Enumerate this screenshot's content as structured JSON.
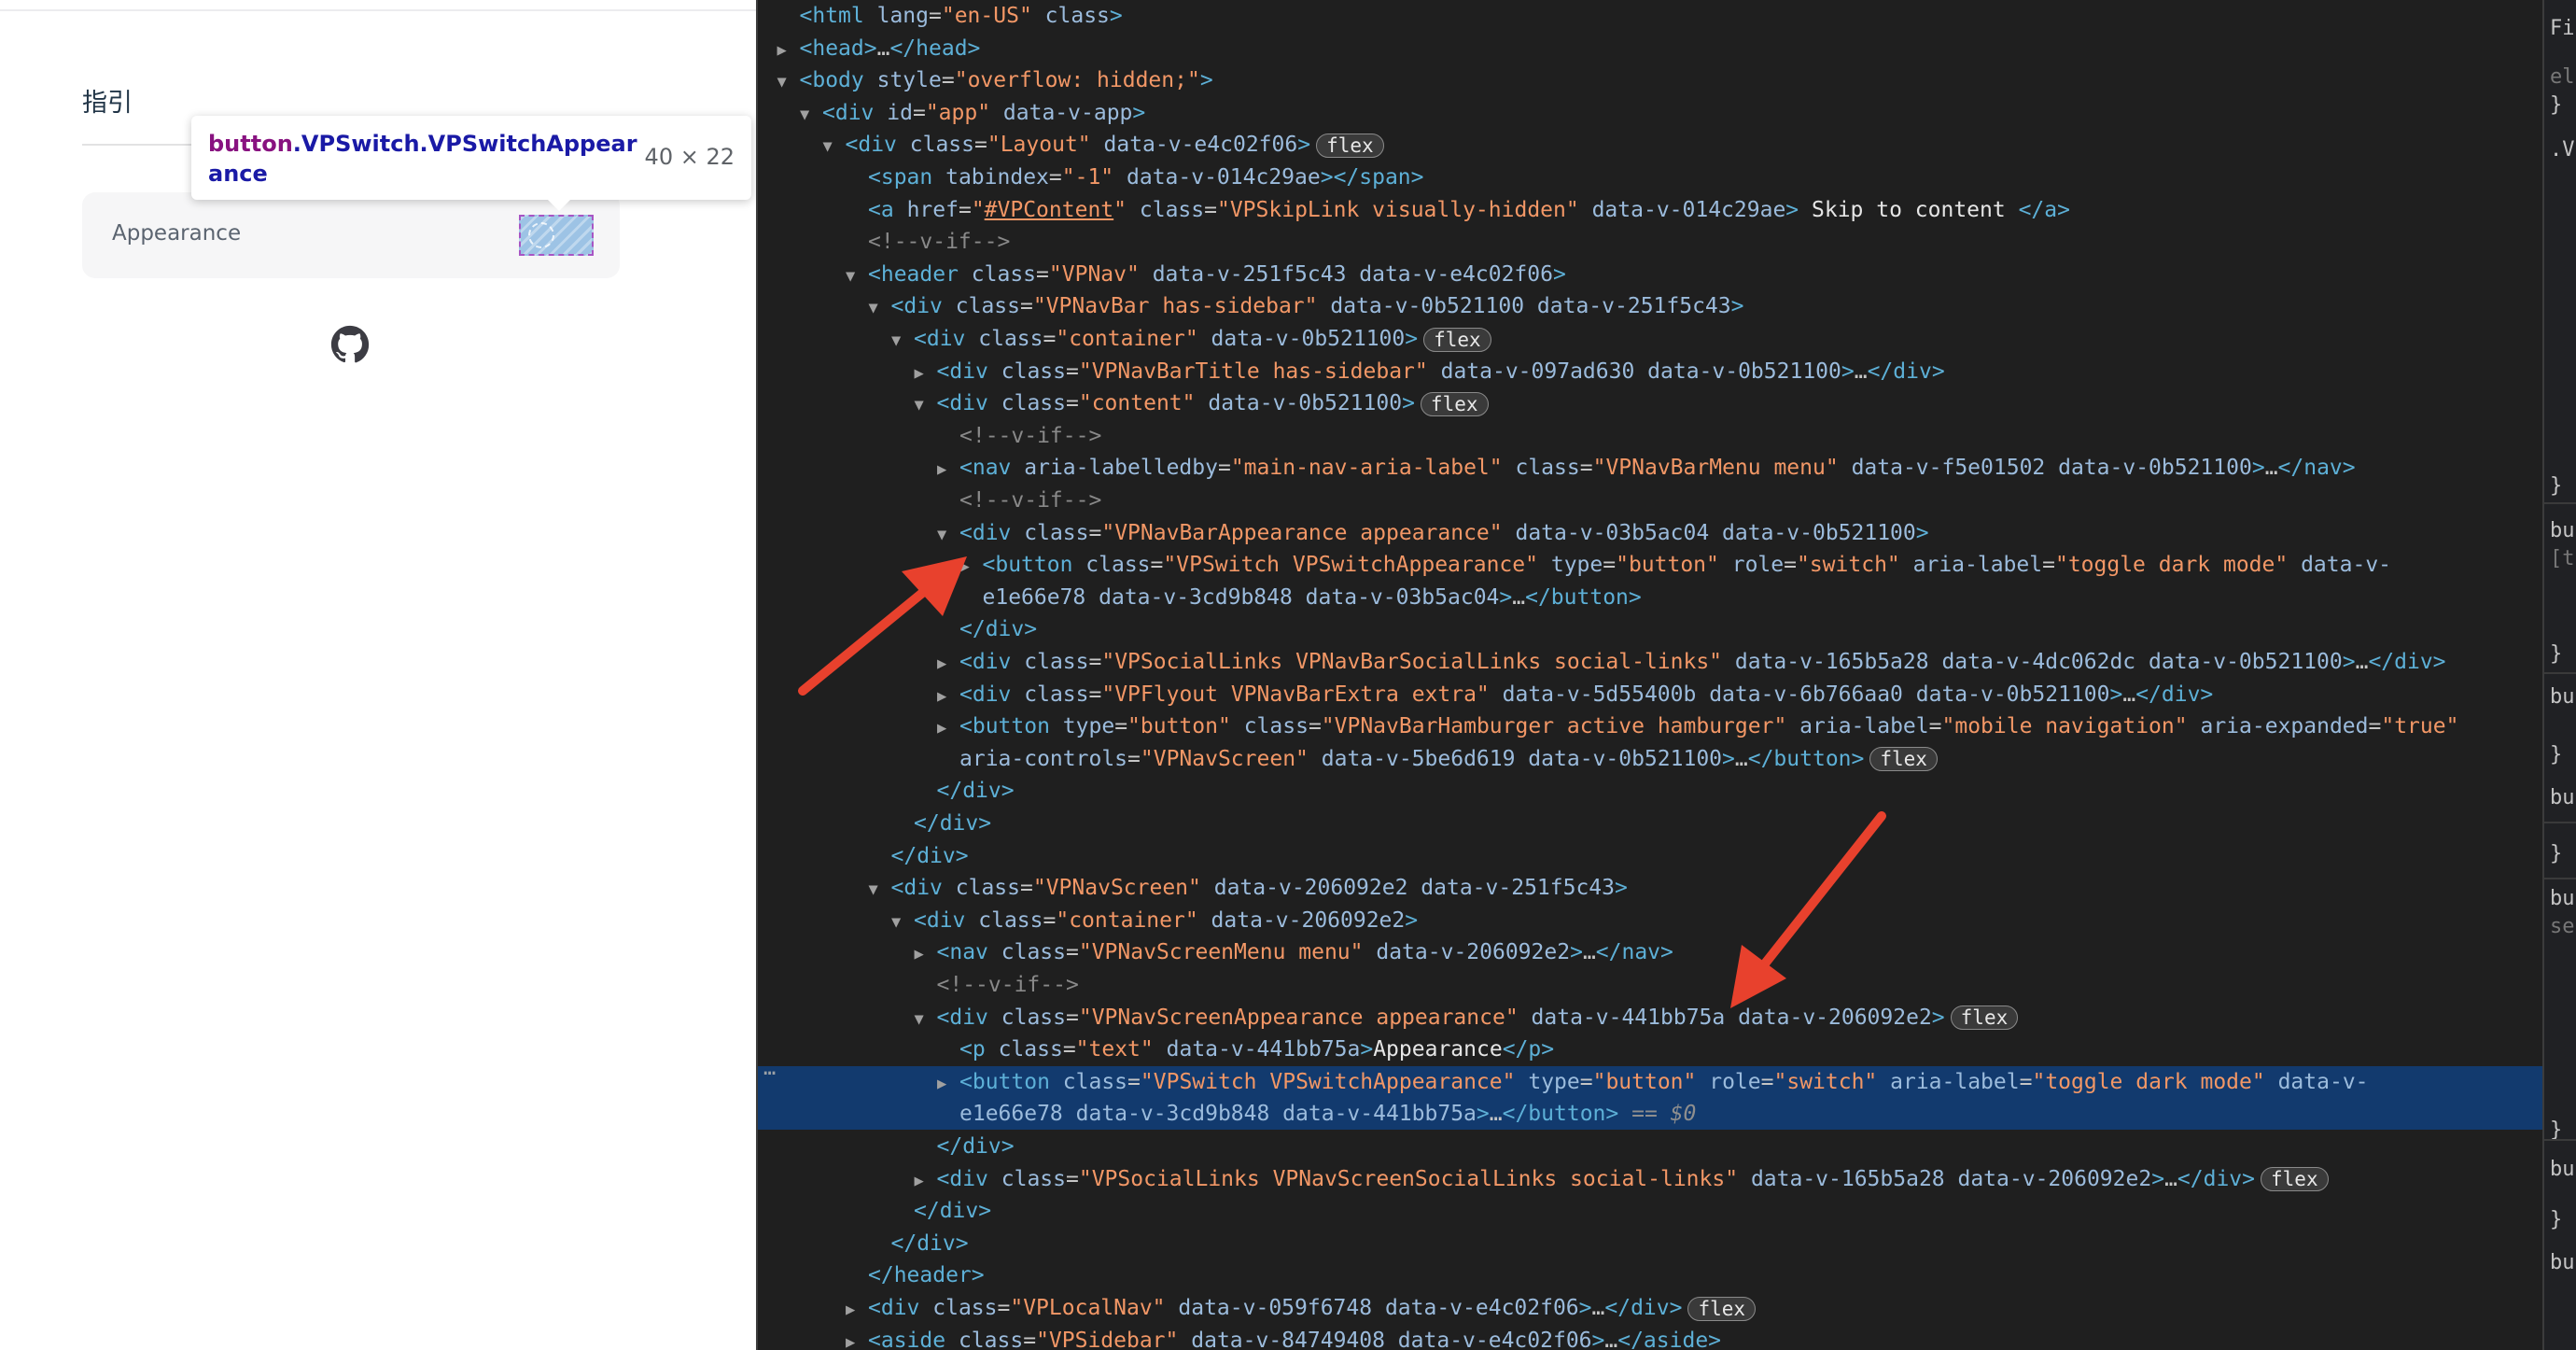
{
  "preview": {
    "nav_title": "指引",
    "appearance_label": "Appearance",
    "tooltip": {
      "tag": "button",
      "classes": ".VPSwitch.VPSwitchAppearance",
      "size": "40 × 22"
    }
  },
  "devtools": {
    "lines": [
      {
        "indent": 1,
        "tw": "",
        "html": "<span class='tag'>&lt;html</span> <span class='an'>lang</span>=<span class='av'>\"en-US\"</span> <span class='an'>class</span><span class='tag'>&gt;</span>"
      },
      {
        "indent": 1,
        "tw": "▶",
        "html": "<span class='tag'>&lt;head&gt;</span>…<span class='tag'>&lt;/head&gt;</span>"
      },
      {
        "indent": 1,
        "tw": "▼",
        "html": "<span class='tag'>&lt;body</span> <span class='an'>style</span>=<span class='av'>\"overflow: hidden;\"</span><span class='tag'>&gt;</span>"
      },
      {
        "indent": 2,
        "tw": "▼",
        "html": "<span class='tag'>&lt;div</span> <span class='an'>id</span>=<span class='av'>\"app\"</span> <span class='an'>data-v-app</span><span class='tag'>&gt;</span>"
      },
      {
        "indent": 3,
        "tw": "▼",
        "html": "<span class='tag'>&lt;div</span> <span class='an'>class</span>=<span class='av'>\"Layout\"</span> <span class='an'>data-v-e4c02f06</span><span class='tag'>&gt;</span>",
        "badge": "flex"
      },
      {
        "indent": 4,
        "tw": "",
        "html": "<span class='tag'>&lt;span</span> <span class='an'>tabindex</span>=<span class='av'>\"-1\"</span> <span class='an'>data-v-014c29ae</span><span class='tag'>&gt;&lt;/span&gt;</span>"
      },
      {
        "indent": 4,
        "tw": "",
        "html": "<span class='tag'>&lt;a</span> <span class='an'>href</span>=<span class='av'>\"</span><span class='lnk'>#VPContent</span><span class='av'>\"</span> <span class='an'>class</span>=<span class='av'>\"VPSkipLink visually-hidden\"</span> <span class='an'>data-v-014c29ae</span><span class='tag'>&gt;</span><span class='tx'> Skip to content </span><span class='tag'>&lt;/a&gt;</span>"
      },
      {
        "indent": 4,
        "tw": "",
        "html": "<span class='cm'>&lt;!--v-if--&gt;</span>"
      },
      {
        "indent": 4,
        "tw": "▼",
        "html": "<span class='tag'>&lt;header</span> <span class='an'>class</span>=<span class='av'>\"VPNav\"</span> <span class='an'>data-v-251f5c43 data-v-e4c02f06</span><span class='tag'>&gt;</span>"
      },
      {
        "indent": 5,
        "tw": "▼",
        "html": "<span class='tag'>&lt;div</span> <span class='an'>class</span>=<span class='av'>\"VPNavBar has-sidebar\"</span> <span class='an'>data-v-0b521100 data-v-251f5c43</span><span class='tag'>&gt;</span>"
      },
      {
        "indent": 6,
        "tw": "▼",
        "html": "<span class='tag'>&lt;div</span> <span class='an'>class</span>=<span class='av'>\"container\"</span> <span class='an'>data-v-0b521100</span><span class='tag'>&gt;</span>",
        "badge": "flex"
      },
      {
        "indent": 7,
        "tw": "▶",
        "html": "<span class='tag'>&lt;div</span> <span class='an'>class</span>=<span class='av'>\"VPNavBarTitle has-sidebar\"</span> <span class='an'>data-v-097ad630 data-v-0b521100</span><span class='tag'>&gt;</span>…<span class='tag'>&lt;/div&gt;</span>"
      },
      {
        "indent": 7,
        "tw": "▼",
        "html": "<span class='tag'>&lt;div</span> <span class='an'>class</span>=<span class='av'>\"content\"</span> <span class='an'>data-v-0b521100</span><span class='tag'>&gt;</span>",
        "badge": "flex"
      },
      {
        "indent": 8,
        "tw": "",
        "html": "<span class='cm'>&lt;!--v-if--&gt;</span>"
      },
      {
        "indent": 8,
        "tw": "▶",
        "html": "<span class='tag'>&lt;nav</span> <span class='an'>aria-labelledby</span>=<span class='av'>\"main-nav-aria-label\"</span> <span class='an'>class</span>=<span class='av'>\"VPNavBarMenu menu\"</span> <span class='an'>data-v-f5e01502 data-v-0b521100</span><span class='tag'>&gt;</span>…<span class='tag'>&lt;/nav&gt;</span>"
      },
      {
        "indent": 8,
        "tw": "",
        "html": "<span class='cm'>&lt;!--v-if--&gt;</span>"
      },
      {
        "indent": 8,
        "tw": "▼",
        "html": "<span class='tag'>&lt;div</span> <span class='an'>class</span>=<span class='av'>\"VPNavBarAppearance appearance\"</span> <span class='an'>data-v-03b5ac04 data-v-0b521100</span><span class='tag'>&gt;</span>"
      },
      {
        "indent": 9,
        "tw": "▶",
        "html": "<span class='tag'>&lt;button</span> <span class='an'>class</span>=<span class='av'>\"VPSwitch VPSwitchAppearance\"</span> <span class='an'>type</span>=<span class='av'>\"button\"</span> <span class='an'>role</span>=<span class='av'>\"switch\"</span> <span class='an'>aria-label</span>=<span class='av'>\"toggle dark mode\"</span> <span class='an'>data-v-</span>"
      },
      {
        "indent": 9,
        "tw": "",
        "html": "<span class='an'>e1e66e78 data-v-3cd9b848 data-v-03b5ac04</span><span class='tag'>&gt;</span>…<span class='tag'>&lt;/button&gt;</span>"
      },
      {
        "indent": 8,
        "tw": "",
        "html": "<span class='tag'>&lt;/div&gt;</span>"
      },
      {
        "indent": 8,
        "tw": "▶",
        "html": "<span class='tag'>&lt;div</span> <span class='an'>class</span>=<span class='av'>\"VPSocialLinks VPNavBarSocialLinks social-links\"</span> <span class='an'>data-v-165b5a28 data-v-4dc062dc data-v-0b521100</span><span class='tag'>&gt;</span>…<span class='tag'>&lt;/div&gt;</span>"
      },
      {
        "indent": 8,
        "tw": "▶",
        "html": "<span class='tag'>&lt;div</span> <span class='an'>class</span>=<span class='av'>\"VPFlyout VPNavBarExtra extra\"</span> <span class='an'>data-v-5d55400b data-v-6b766aa0 data-v-0b521100</span><span class='tag'>&gt;</span>…<span class='tag'>&lt;/div&gt;</span>"
      },
      {
        "indent": 8,
        "tw": "▶",
        "html": "<span class='tag'>&lt;button</span> <span class='an'>type</span>=<span class='av'>\"button\"</span> <span class='an'>class</span>=<span class='av'>\"VPNavBarHamburger active hamburger\"</span> <span class='an'>aria-label</span>=<span class='av'>\"mobile navigation\"</span> <span class='an'>aria-expanded</span>=<span class='av'>\"true\"</span>"
      },
      {
        "indent": 8,
        "tw": "",
        "html": "<span class='an'>aria-controls</span>=<span class='av'>\"VPNavScreen\"</span> <span class='an'>data-v-5be6d619 data-v-0b521100</span><span class='tag'>&gt;</span>…<span class='tag'>&lt;/button&gt;</span>",
        "badge": "flex"
      },
      {
        "indent": 7,
        "tw": "",
        "html": "<span class='tag'>&lt;/div&gt;</span>"
      },
      {
        "indent": 6,
        "tw": "",
        "html": "<span class='tag'>&lt;/div&gt;</span>"
      },
      {
        "indent": 5,
        "tw": "",
        "html": "<span class='tag'>&lt;/div&gt;</span>"
      },
      {
        "indent": 5,
        "tw": "▼",
        "html": "<span class='tag'>&lt;div</span> <span class='an'>class</span>=<span class='av'>\"VPNavScreen\"</span> <span class='an'>data-v-206092e2 data-v-251f5c43</span><span class='tag'>&gt;</span>"
      },
      {
        "indent": 6,
        "tw": "▼",
        "html": "<span class='tag'>&lt;div</span> <span class='an'>class</span>=<span class='av'>\"container\"</span> <span class='an'>data-v-206092e2</span><span class='tag'>&gt;</span>"
      },
      {
        "indent": 7,
        "tw": "▶",
        "html": "<span class='tag'>&lt;nav</span> <span class='an'>class</span>=<span class='av'>\"VPNavScreenMenu menu\"</span> <span class='an'>data-v-206092e2</span><span class='tag'>&gt;</span>…<span class='tag'>&lt;/nav&gt;</span>"
      },
      {
        "indent": 7,
        "tw": "",
        "html": "<span class='cm'>&lt;!--v-if--&gt;</span>"
      },
      {
        "indent": 7,
        "tw": "▼",
        "html": "<span class='tag'>&lt;div</span> <span class='an'>class</span>=<span class='av'>\"VPNavScreenAppearance appearance\"</span> <span class='an'>data-v-441bb75a data-v-206092e2</span><span class='tag'>&gt;</span>",
        "badge": "flex"
      },
      {
        "indent": 8,
        "tw": "",
        "html": "<span class='tag'>&lt;p</span> <span class='an'>class</span>=<span class='av'>\"text\"</span> <span class='an'>data-v-441bb75a</span><span class='tag'>&gt;</span><span class='tx'>Appearance</span><span class='tag'>&lt;/p&gt;</span>"
      },
      {
        "indent": 8,
        "tw": "▶",
        "sel": true,
        "html": "<span class='tag'>&lt;button</span> <span class='an'>class</span>=<span class='av'>\"VPSwitch VPSwitchAppearance\"</span> <span class='an'>type</span>=<span class='av'>\"button\"</span> <span class='an'>role</span>=<span class='av'>\"switch\"</span> <span class='an'>aria-label</span>=<span class='av'>\"toggle dark mode\"</span> <span class='an'>data-v-</span>"
      },
      {
        "indent": 8,
        "tw": "",
        "sel": true,
        "html": "<span class='an'>e1e66e78 data-v-3cd9b848 data-v-441bb75a</span><span class='tag'>&gt;</span>…<span class='tag'>&lt;/button&gt;</span> <span class='eq'>== $0</span>"
      },
      {
        "indent": 7,
        "tw": "",
        "html": "<span class='tag'>&lt;/div&gt;</span>"
      },
      {
        "indent": 7,
        "tw": "▶",
        "html": "<span class='tag'>&lt;div</span> <span class='an'>class</span>=<span class='av'>\"VPSocialLinks VPNavScreenSocialLinks social-links\"</span> <span class='an'>data-v-165b5a28 data-v-206092e2</span><span class='tag'>&gt;</span>…<span class='tag'>&lt;/div&gt;</span>",
        "badge": "flex"
      },
      {
        "indent": 6,
        "tw": "",
        "html": "<span class='tag'>&lt;/div&gt;</span>"
      },
      {
        "indent": 5,
        "tw": "",
        "html": "<span class='tag'>&lt;/div&gt;</span>"
      },
      {
        "indent": 4,
        "tw": "",
        "html": "<span class='tag'>&lt;/header&gt;</span>"
      },
      {
        "indent": 4,
        "tw": "▶",
        "html": "<span class='tag'>&lt;div</span> <span class='an'>class</span>=<span class='av'>\"VPLocalNav\"</span> <span class='an'>data-v-059f6748 data-v-e4c02f06</span><span class='tag'>&gt;</span>…<span class='tag'>&lt;/div&gt;</span>",
        "badge": "flex"
      },
      {
        "indent": 4,
        "tw": "▶",
        "html": "<span class='tag'>&lt;aside</span> <span class='an'>class</span>=<span class='av'>\"VPSidebar\"</span> <span class='an'>data-v-84749408 data-v-e4c02f06</span><span class='tag'>&gt;</span>…<span class='tag'>&lt;/aside&gt;</span>"
      }
    ],
    "gutter": "…",
    "styles_strip": [
      "Fi",
      "el",
      "}",
      ".V",
      "}",
      "bu",
      "[t",
      "}",
      "bu",
      "}",
      "bu",
      "}",
      "bu",
      "se",
      "}",
      "bu",
      "}",
      "bu"
    ]
  }
}
